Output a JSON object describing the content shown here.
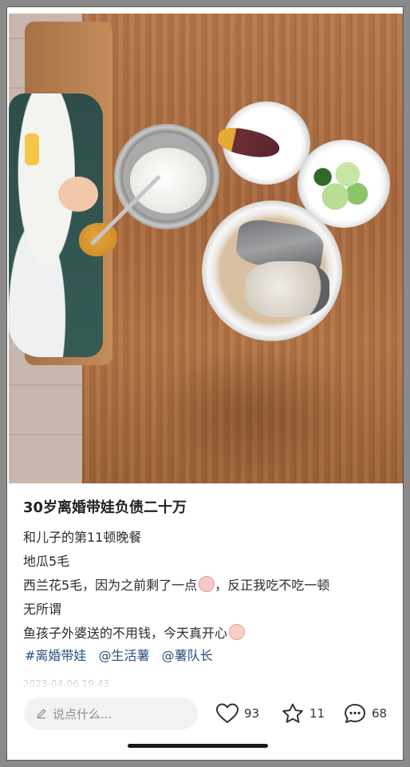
{
  "post": {
    "title": "30岁离婚带娃负债二十万",
    "lines": [
      "和儿子的第11顿晚餐",
      "地瓜5毛",
      "西兰花5毛，因为之前剩了一点",
      "，反正我吃不吃一顿",
      "无所谓",
      "鱼孩子外婆送的不用钱，今天真开心"
    ],
    "tags": [
      "#离婚带娃",
      "@生活薯",
      "@薯队长"
    ],
    "date": "2023-04-06 19:43"
  },
  "bottom_bar": {
    "comment_placeholder": "说点什么...",
    "like_count": "93",
    "star_count": "11",
    "comment_count": "68"
  },
  "icons": {
    "comment_box": "pen-icon",
    "like": "heart-icon",
    "star": "star-icon",
    "comment": "comment-bubble-icon",
    "emoji_1": "crying-face-emoji",
    "emoji_2": "happy-pig-emoji"
  }
}
